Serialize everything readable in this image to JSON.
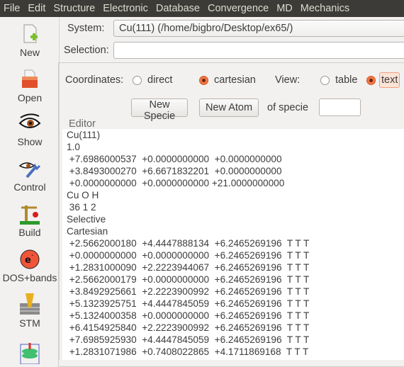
{
  "menu": [
    "File",
    "Edit",
    "Structure",
    "Electronic",
    "Database",
    "Convergence",
    "MD",
    "Mechanics"
  ],
  "sidebar": [
    {
      "label": "New",
      "icon": "new-file-icon"
    },
    {
      "label": "Open",
      "icon": "open-folder-icon"
    },
    {
      "label": "Show",
      "icon": "eye-icon"
    },
    {
      "label": "Control",
      "icon": "eye-wrench-icon"
    },
    {
      "label": "Build",
      "icon": "crane-icon"
    },
    {
      "label": "DOS+bands",
      "icon": "electron-icon"
    },
    {
      "label": "STM",
      "icon": "stm-tip-icon"
    },
    {
      "label": "",
      "icon": "stack-icon"
    }
  ],
  "system": {
    "label": "System:",
    "value": "Cu(111) (/home/bigbro/Desktop/ex65/)"
  },
  "selection": {
    "label": "Selection:",
    "value": ""
  },
  "coordinates": {
    "label": "Coordinates:",
    "options": [
      "direct",
      "cartesian"
    ],
    "selected": "cartesian"
  },
  "view": {
    "label": "View:",
    "options": [
      "table",
      "text"
    ],
    "selected": "text"
  },
  "buttons": {
    "new_specie": "New Specie",
    "new_atom": "New Atom",
    "of_specie": "of specie",
    "specie_value": ""
  },
  "editor": {
    "label": "Editor",
    "lines": [
      "Cu(111)",
      "1.0",
      " +7.6986000537  +0.0000000000  +0.0000000000",
      " +3.8493000270  +6.6671832201  +0.0000000000",
      " +0.0000000000  +0.0000000000 +21.0000000000",
      "Cu O H",
      " 36 1 2",
      "Selective",
      "Cartesian",
      " +2.5662000180  +4.4447888134  +6.2465269196  T T T",
      " +0.0000000000  +0.0000000000  +6.2465269196  T T T",
      " +1.2831000090  +2.2223944067  +6.2465269196  T T T",
      " +2.5662000179  +0.0000000000  +6.2465269196  T T T",
      " +3.8492925661  +2.2223900992  +6.2465269196  T T T",
      " +5.1323925751  +4.4447845059  +6.2465269196  T T T",
      " +5.1324000358  +0.0000000000  +6.2465269196  T T T",
      " +6.4154925840  +2.2223900992  +6.2465269196  T T T",
      " +7.6985925930  +4.4447845059  +6.2465269196  T T T",
      " +1.2831071986  +0.7408022865  +4.1711869168  T T T"
    ]
  }
}
